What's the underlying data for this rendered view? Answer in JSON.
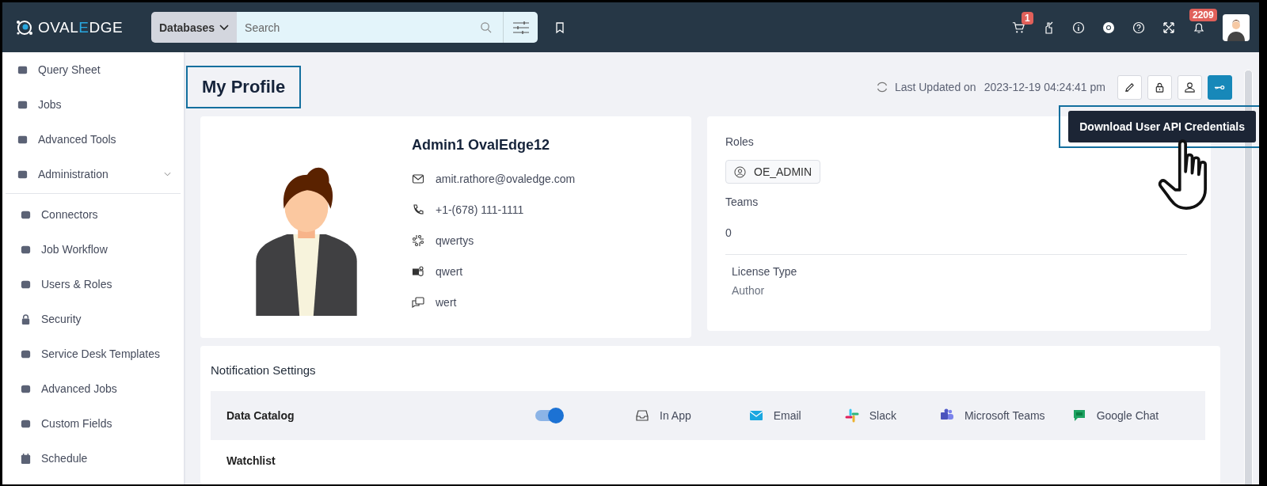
{
  "topbar": {
    "logo": {
      "before": "OVAL",
      "accent": "E",
      "after": "DGE"
    },
    "search": {
      "scope": "Databases",
      "placeholder": "Search"
    },
    "cart_count": "1",
    "notification_count": "2209"
  },
  "sidebar": {
    "items": [
      {
        "label": "Query Sheet"
      },
      {
        "label": "Jobs"
      },
      {
        "label": "Advanced Tools"
      },
      {
        "label": "Administration",
        "expanded": true,
        "children": [
          {
            "label": "Connectors"
          },
          {
            "label": "Job Workflow"
          },
          {
            "label": "Users & Roles"
          },
          {
            "label": "Security"
          },
          {
            "label": "Service Desk Templates"
          },
          {
            "label": "Advanced Jobs"
          },
          {
            "label": "Custom Fields"
          },
          {
            "label": "Schedule"
          }
        ]
      }
    ]
  },
  "page": {
    "title": "My Profile",
    "last_updated_label": "Last Updated on",
    "last_updated": "2023-12-19 04:24:41 pm",
    "actions": [
      {
        "selected": false
      },
      {
        "selected": false
      },
      {
        "selected": false
      },
      {
        "selected": true
      }
    ],
    "tooltip": "Download User API Credentials"
  },
  "profile": {
    "name": "Admin1 OvalEdge12",
    "details": [
      "amit.rathore@ovaledge.com",
      "+1-(678) 111-1111",
      "qwertys",
      "qwert",
      "wert"
    ]
  },
  "roles_card": {
    "roles_label": "Roles",
    "roles": [
      "OE_ADMIN"
    ],
    "teams_label": "Teams",
    "teams": "0",
    "license_label": "License Type",
    "license": "Author"
  },
  "notifications": {
    "title": "Notification Settings",
    "rows": [
      {
        "label": "Data Catalog",
        "on": true,
        "channels": [
          "In App",
          "Email",
          "Slack",
          "Microsoft Teams",
          "Google Chat"
        ]
      },
      {
        "label": "Watchlist"
      }
    ]
  }
}
